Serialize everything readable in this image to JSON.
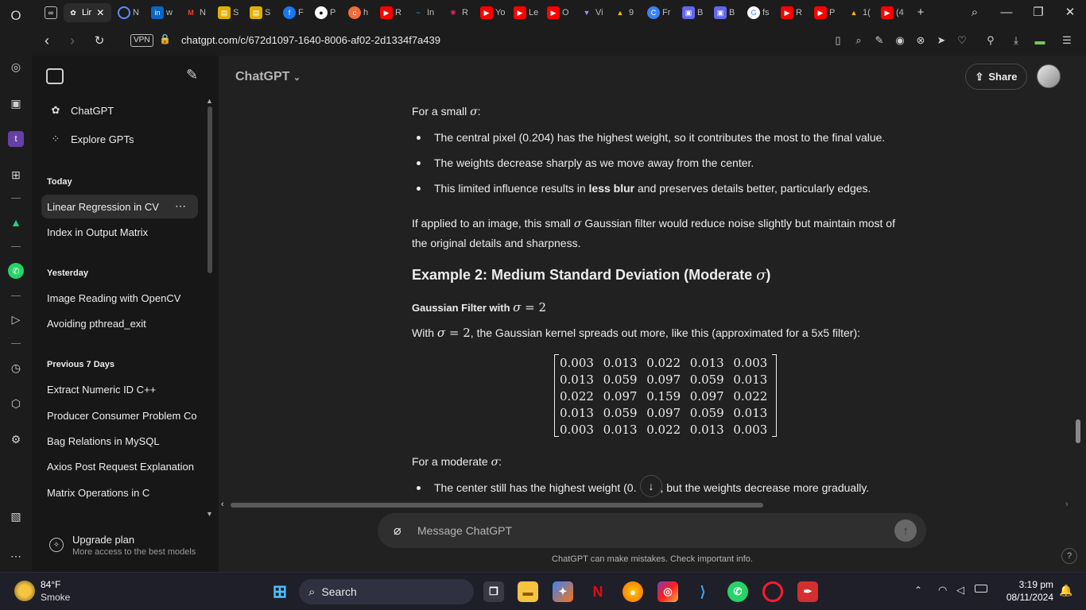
{
  "browser": {
    "tabs": [
      {
        "label": "Lir",
        "active": true
      },
      {
        "label": "N"
      },
      {
        "label": "w"
      },
      {
        "label": "N"
      },
      {
        "label": "S"
      },
      {
        "label": "S"
      },
      {
        "label": "F"
      },
      {
        "label": "P"
      },
      {
        "label": "h"
      },
      {
        "label": "R"
      },
      {
        "label": "In"
      },
      {
        "label": "R"
      },
      {
        "label": "Yo"
      },
      {
        "label": "Le"
      },
      {
        "label": "O"
      },
      {
        "label": "Vi"
      },
      {
        "label": "9"
      },
      {
        "label": "Fr"
      },
      {
        "label": "B"
      },
      {
        "label": "B"
      },
      {
        "label": "fs"
      },
      {
        "label": "R"
      },
      {
        "label": "P"
      },
      {
        "label": "1("
      },
      {
        "label": "(4"
      }
    ],
    "vpn_label": "VPN",
    "url": "chatgpt.com/c/672d1097-1640-8006-af02-2d1334f7a439"
  },
  "sidebar": {
    "items_top": [
      {
        "label": "ChatGPT",
        "icon": "openai-logo-icon"
      },
      {
        "label": "Explore GPTs",
        "icon": "grid-icon"
      }
    ],
    "sections": [
      {
        "heading": "Today",
        "items": [
          "Linear Regression in CV",
          "Index in Output Matrix"
        ]
      },
      {
        "heading": "Yesterday",
        "items": [
          "Image Reading with OpenCV",
          "Avoiding pthread_exit"
        ]
      },
      {
        "heading": "Previous 7 Days",
        "items": [
          "Extract Numeric ID C++",
          "Producer Consumer Problem Co",
          "Bag Relations in MySQL",
          "Axios Post Request Explanation",
          "Matrix Operations in C"
        ]
      }
    ],
    "upgrade": {
      "title": "Upgrade plan",
      "subtitle": "More access to the best models"
    }
  },
  "header": {
    "model": "ChatGPT",
    "share_label": "Share"
  },
  "content": {
    "small_intro_pre": "For a small ",
    "sigma": "σ",
    "colon": ":",
    "bullets_small": [
      "The central pixel (0.204) has the highest weight, so it contributes the most to the final value.",
      "The weights decrease sharply as we move away from the center."
    ],
    "bullet3_pre": "This limited influence results in ",
    "bullet3_bold": "less blur",
    "bullet3_post": " and preserves details better, particularly edges.",
    "para1_pre": "If applied to an image, this small ",
    "para1_post": " Gaussian filter would reduce noise slightly but maintain most of",
    "para1_line2": "the original details and sharpness.",
    "heading2_pre": "Example 2: Medium Standard Deviation (Moderate ",
    "heading2_post": ")",
    "subheading_pre": "Gaussian Filter with ",
    "math_eq": " = 2",
    "with_pre": "With ",
    "with_post": ", the Gaussian kernel spreads out more, like this (approximated for a 5x5 filter):",
    "matrix": [
      [
        "0.003",
        "0.013",
        "0.022",
        "0.013",
        "0.003"
      ],
      [
        "0.013",
        "0.059",
        "0.097",
        "0.059",
        "0.013"
      ],
      [
        "0.022",
        "0.097",
        "0.159",
        "0.097",
        "0.022"
      ],
      [
        "0.013",
        "0.059",
        "0.097",
        "0.059",
        "0.013"
      ],
      [
        "0.003",
        "0.013",
        "0.022",
        "0.013",
        "0.003"
      ]
    ],
    "moderate_pre": "For a moderate ",
    "last_bullet_pre": "The center still has the highest weight (0.",
    "last_bullet_post": ", but the weights decrease more gradually."
  },
  "composer": {
    "placeholder": "Message ChatGPT",
    "disclaimer": "ChatGPT can make mistakes. Check important info.",
    "help": "?"
  },
  "taskbar": {
    "weather_temp": "84°F",
    "weather_desc": "Smoke",
    "search_label": "Search",
    "time": "3:19 pm",
    "date": "08/11/2024"
  }
}
